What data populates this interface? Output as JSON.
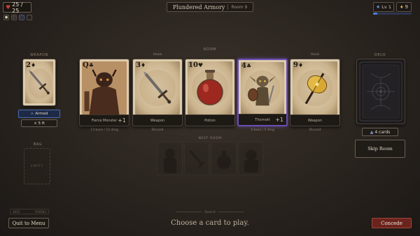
{
  "hud": {
    "hp": "25 / 25",
    "slots": [
      {
        "icon": "circle-icon",
        "glyph": "●",
        "tone": "plain"
      },
      {
        "icon": "ring-icon",
        "glyph": "○",
        "tone": "plain"
      },
      {
        "icon": "blue-ring-icon",
        "glyph": "○",
        "tone": "blue"
      },
      {
        "icon": "slot-empty-icon",
        "glyph": "",
        "tone": "plain"
      }
    ],
    "level": "Lv 1",
    "gold": "9",
    "xp_progress": 0.1
  },
  "header": {
    "title": "Plundered Armory",
    "room": "Room 9"
  },
  "weapon": {
    "label": "WEAPON",
    "rank": "2",
    "suit": "♦",
    "status": "Armed",
    "damage": "× 5 ft"
  },
  "bag": {
    "label": "BAG",
    "empty_text": "Empty"
  },
  "room": {
    "label": "ROOM",
    "cards": [
      {
        "rank": "Q",
        "suit": "♣",
        "color": "black",
        "tag": "",
        "name": "Fierce Monster",
        "plus": "+1",
        "under": "13 base / 12 dmg",
        "art": "monster",
        "selected": false
      },
      {
        "rank": "3",
        "suit": "♦",
        "color": "black",
        "tag": "Heals",
        "name": "Weapon",
        "plus": "",
        "under": "Discard",
        "art": "dagger",
        "selected": false
      },
      {
        "rank": "10",
        "suit": "♥",
        "color": "black",
        "tag": "",
        "name": "Potion",
        "plus": "",
        "under": "",
        "art": "potion",
        "selected": false
      },
      {
        "rank": "4",
        "suit": "♣",
        "color": "black",
        "tag": "",
        "name": "Thornett",
        "plus": "+1",
        "under": "4 base / 5 dmg",
        "art": "goblin",
        "selected": true
      },
      {
        "rank": "9",
        "suit": "♦",
        "color": "black",
        "tag": "Heals",
        "name": "Weapon",
        "plus": "",
        "under": "Discard",
        "art": "axe",
        "selected": false
      }
    ]
  },
  "next_room": {
    "label": "NEXT ROOM"
  },
  "deck": {
    "label": "DECK",
    "count": "4 cards"
  },
  "actions": {
    "skip": "Skip Room",
    "quit": "Quit to Menu",
    "concede": "Concede",
    "prompt": "Choose a card to play.",
    "room_footer": "Room 9"
  },
  "stats_row": {
    "left": "4850",
    "right": "#00083"
  },
  "colors": {
    "selected_border": "#6a4fb0",
    "weapon_button": "#3a5a9a",
    "concede": "#7a2a22",
    "hp_heart": "#c8403a"
  }
}
